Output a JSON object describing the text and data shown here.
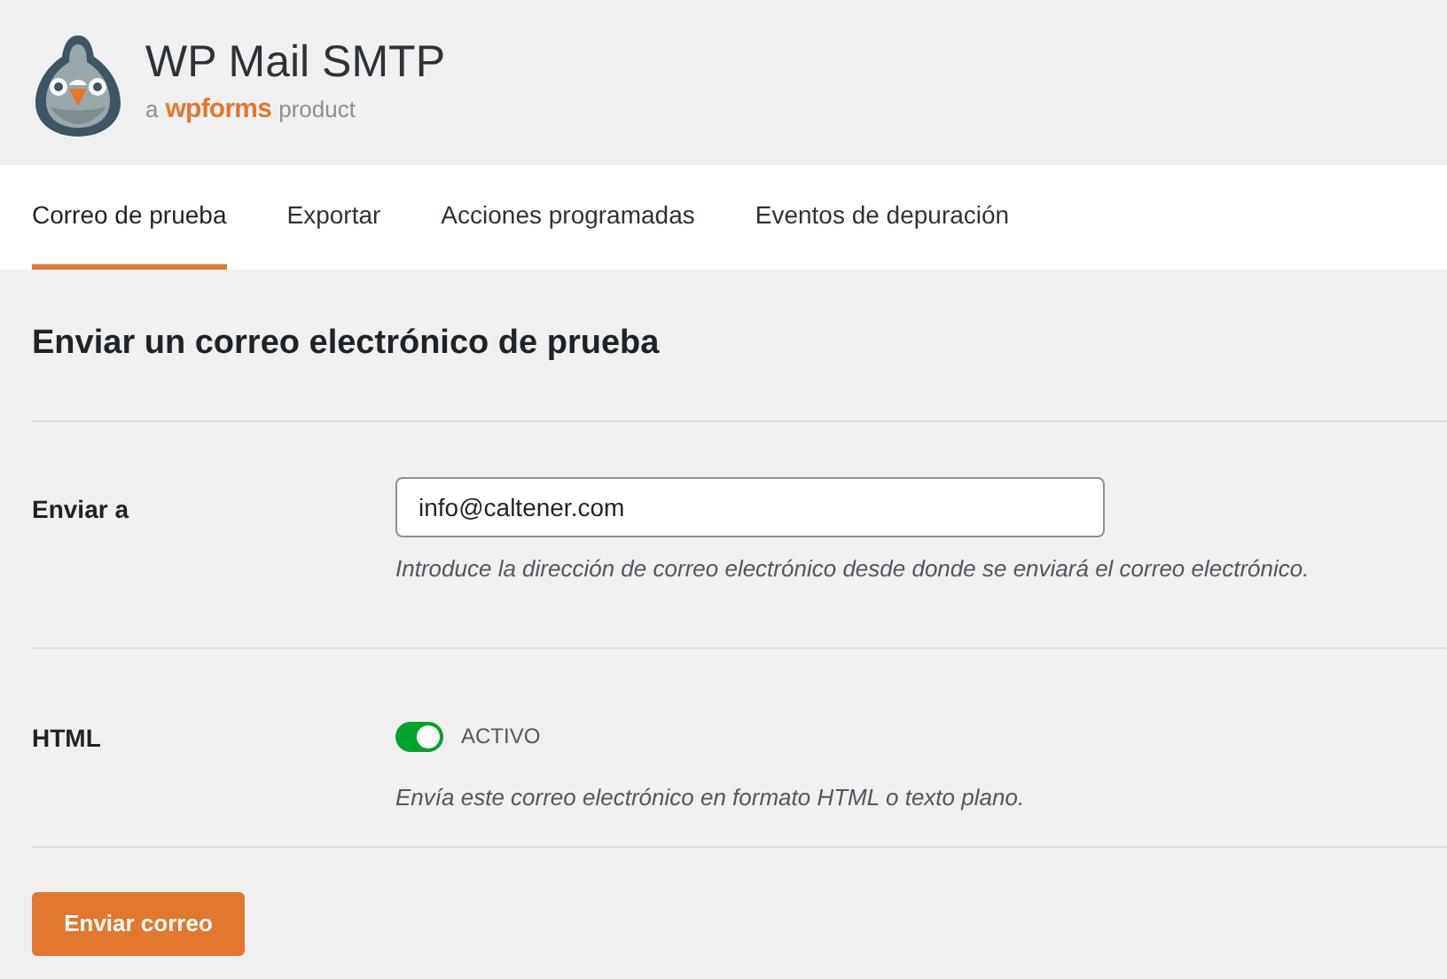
{
  "header": {
    "title": "WP Mail SMTP",
    "tagline": {
      "prefix": "a",
      "brand": "wpforms",
      "suffix": "product"
    }
  },
  "tabs": [
    {
      "label": "Correo de prueba",
      "selected": true
    },
    {
      "label": "Exportar",
      "selected": false
    },
    {
      "label": "Acciones programadas",
      "selected": false
    },
    {
      "label": "Eventos de depuración",
      "selected": false
    }
  ],
  "section": {
    "title": "Enviar un correo electrónico de prueba"
  },
  "fields": [
    {
      "kind": "text",
      "label": "Enviar a",
      "value": "info@caltener.com",
      "hint": "Introduce la dirección de correo electrónico desde donde se enviará el correo electrónico."
    },
    {
      "kind": "toggle",
      "label": "HTML",
      "on": true,
      "state_label": "ACTIVO",
      "hint": "Envía este correo electrónico en formato HTML o texto plano."
    }
  ],
  "submit": {
    "label": "Enviar correo"
  }
}
